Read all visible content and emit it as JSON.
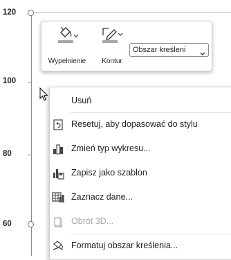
{
  "chart": {
    "y_labels": [
      "120",
      "100",
      "80",
      "60"
    ]
  },
  "mini_toolbar": {
    "fill_label": "Wypełnienie",
    "outline_label": "Kontur",
    "area_select_value": "Obszar kreśleni"
  },
  "context_menu": {
    "items": [
      {
        "label": "Usuń",
        "icon": "none",
        "enabled": true
      },
      {
        "label": "Resetuj, aby dopasować do stylu",
        "icon": "reset-style-icon",
        "enabled": true
      },
      {
        "label": "Zmień typ wykresu...",
        "icon": "chart-type-icon",
        "enabled": true
      },
      {
        "label": "Zapisz jako szablon",
        "icon": "save-template-icon",
        "enabled": true
      },
      {
        "label": "Zaznacz dane...",
        "icon": "select-data-icon",
        "enabled": true
      },
      {
        "label": "Obrót 3D...",
        "icon": "rotation-3d-icon",
        "enabled": false
      },
      {
        "label": "Formatuj obszar kreślenia...",
        "icon": "format-area-icon",
        "enabled": true
      }
    ]
  }
}
